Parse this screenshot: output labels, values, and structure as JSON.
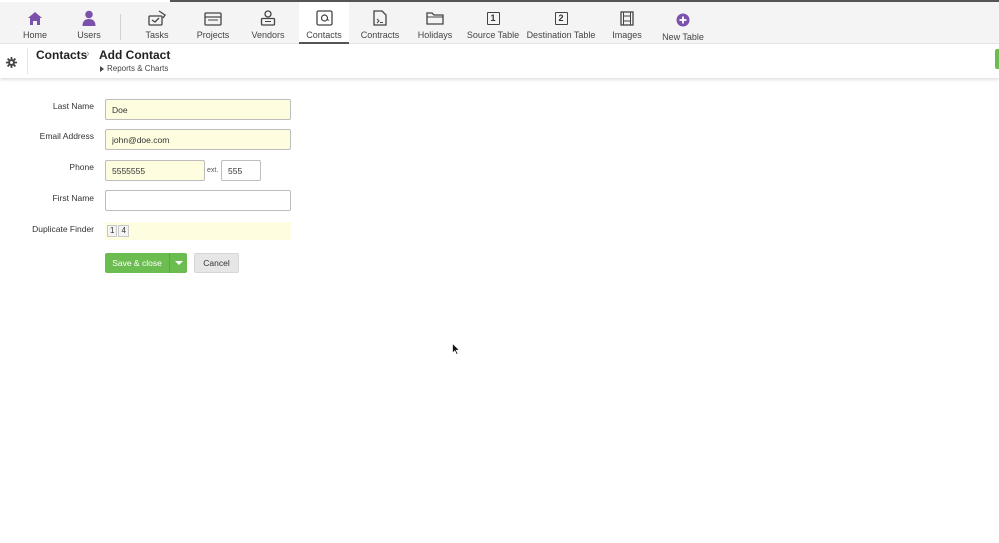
{
  "nav": {
    "items": [
      {
        "label": "Home",
        "icon": "home-icon"
      },
      {
        "label": "Users",
        "icon": "user-icon"
      },
      {
        "label": "Tasks",
        "icon": "tasks-icon"
      },
      {
        "label": "Projects",
        "icon": "projects-icon"
      },
      {
        "label": "Vendors",
        "icon": "vendors-icon"
      },
      {
        "label": "Contacts",
        "icon": "contacts-icon"
      },
      {
        "label": "Contracts",
        "icon": "contracts-icon"
      },
      {
        "label": "Holidays",
        "icon": "folder-icon"
      },
      {
        "label": "Source Table",
        "icon": "number-1-icon",
        "number": "1"
      },
      {
        "label": "Destination Table",
        "icon": "number-2-icon",
        "number": "2"
      },
      {
        "label": "Images",
        "icon": "film-icon"
      },
      {
        "label": "New Table",
        "icon": "plus-circle-icon"
      }
    ],
    "active": "Contacts"
  },
  "header": {
    "breadcrumb": "Contacts",
    "breadcrumb_sep": "›",
    "title": "Add Contact",
    "reports_link": "Reports & Charts"
  },
  "form": {
    "last_name": {
      "label": "Last Name",
      "value": "Doe"
    },
    "email": {
      "label": "Email Address",
      "value": "john@doe.com"
    },
    "phone": {
      "label": "Phone",
      "value": "5555555",
      "ext_label": "ext.",
      "ext_value": "555"
    },
    "first_name": {
      "label": "First Name",
      "value": ""
    },
    "duplicate_finder": {
      "label": "Duplicate Finder",
      "chips": [
        "1",
        "4"
      ]
    }
  },
  "actions": {
    "save_label": "Save & close",
    "cancel_label": "Cancel"
  },
  "colors": {
    "accent_purple": "#7b52ab",
    "save_green": "#6cbd4f",
    "filled_field": "#fffde0"
  }
}
